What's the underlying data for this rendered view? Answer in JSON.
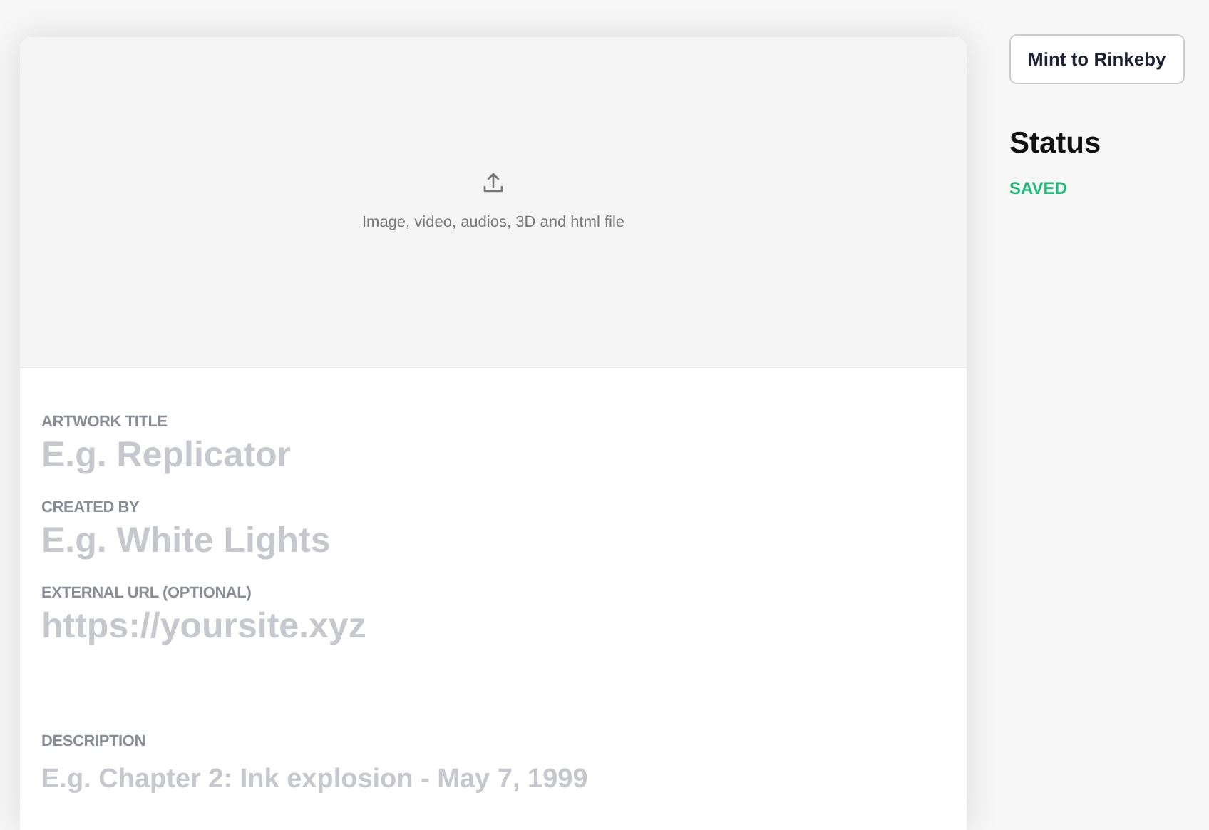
{
  "upload": {
    "hint": "Image, video, audios, 3D and html file"
  },
  "fields": [
    {
      "kind": "input",
      "label": "ARTWORK TITLE",
      "placeholder": "E.g. Replicator"
    },
    {
      "kind": "input",
      "label": "CREATED BY",
      "placeholder": "E.g. White Lights"
    },
    {
      "kind": "input",
      "label": "EXTERNAL URL (OPTIONAL)",
      "placeholder": "https://yoursite.xyz"
    },
    {
      "kind": "textarea",
      "label": "DESCRIPTION",
      "placeholder": "E.g. Chapter 2: Ink explosion - May 7, 1999"
    }
  ],
  "mint_button": "Mint to Rinkeby",
  "status": {
    "heading": "Status",
    "value": "SAVED"
  }
}
